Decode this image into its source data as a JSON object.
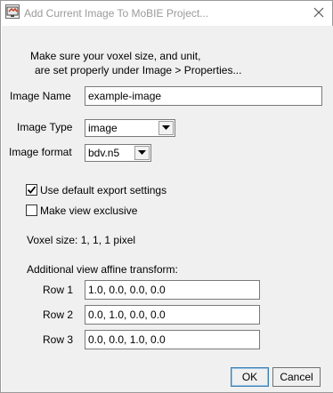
{
  "dialog": {
    "title": "Add Current Image To MoBIE Project...",
    "instructions": {
      "line1": "Make sure your voxel size, and unit,",
      "line2": "are set properly under Image > Properties..."
    }
  },
  "fields": {
    "image_name": {
      "label": "Image Name",
      "value": "example-image"
    },
    "image_type": {
      "label": "Image Type",
      "selected": "image"
    },
    "image_format": {
      "label": "Image format",
      "selected": "bdv.n5"
    }
  },
  "options": {
    "use_default_export": {
      "label": "Use default export settings",
      "checked": true
    },
    "make_view_exclusive": {
      "label": "Make view exclusive",
      "checked": false
    }
  },
  "voxel_size": "Voxel size: 1, 1, 1 pixel",
  "affine": {
    "heading": "Additional view affine transform:",
    "rows": [
      {
        "label": "Row 1",
        "value": "1.0, 0.0, 0.0, 0.0"
      },
      {
        "label": "Row 2",
        "value": "0.0, 1.0, 0.0, 0.0"
      },
      {
        "label": "Row 3",
        "value": "0.0, 0.0, 1.0, 0.0"
      }
    ]
  },
  "buttons": {
    "ok": "OK",
    "cancel": "Cancel"
  },
  "icons": {
    "app": "imagej-icon",
    "close": "close-icon",
    "dropdown": "chevron-down-icon",
    "check": "checkmark-icon"
  }
}
